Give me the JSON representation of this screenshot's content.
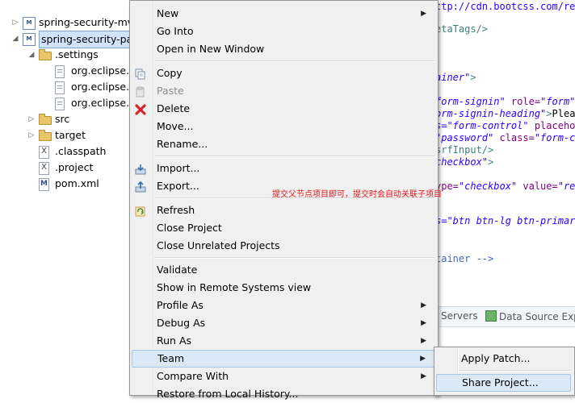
{
  "explorer": {
    "items": [
      {
        "label": "spring-security-mv",
        "icon": "maven-project-icon",
        "arrow": "▷",
        "selected": false
      },
      {
        "label": "spring-security-par",
        "icon": "maven-project-icon",
        "arrow": "◢",
        "selected": true
      },
      {
        "label": ".settings",
        "icon": "folder-open-icon",
        "arrow": "◢",
        "selected": false
      },
      {
        "label": "org.eclipse.c",
        "icon": "file-icon",
        "arrow": "",
        "selected": false
      },
      {
        "label": "org.eclipse.j",
        "icon": "file-icon",
        "arrow": "",
        "selected": false
      },
      {
        "label": "org.eclipse.r",
        "icon": "file-icon",
        "arrow": "",
        "selected": false
      },
      {
        "label": "src",
        "icon": "folder-icon",
        "arrow": "▷",
        "selected": false
      },
      {
        "label": "target",
        "icon": "folder-icon",
        "arrow": "▷",
        "selected": false
      },
      {
        "label": ".classpath",
        "icon": "xml-file-icon",
        "arrow": "",
        "selected": false
      },
      {
        "label": ".project",
        "icon": "xml-file-icon",
        "arrow": "",
        "selected": false
      },
      {
        "label": "pom.xml",
        "icon": "maven-file-icon",
        "arrow": "",
        "selected": false
      }
    ]
  },
  "editor": {
    "lines": [
      {
        "parts": [
          {
            "t": "url",
            "v": "ttp://cdn.bootcss.com/res"
          }
        ]
      },
      {
        "parts": [
          {
            "t": "tag",
            "v": "etaTags/>"
          }
        ]
      },
      {
        "parts": [
          {
            "t": "str",
            "v": "ainer\""
          },
          {
            "t": "tag",
            "v": ">"
          }
        ]
      },
      {
        "parts": [
          {
            "t": "str",
            "v": "form-signin\""
          },
          {
            "t": "attr",
            "v": " role="
          },
          {
            "t": "str",
            "v": "\"form\""
          }
        ]
      },
      {
        "parts": [
          {
            "t": "str",
            "v": "orm-signin-heading\""
          },
          {
            "t": "tag",
            "v": ">"
          },
          {
            "t": "txt",
            "v": "Pleas"
          }
        ]
      },
      {
        "parts": [
          {
            "t": "str",
            "v": "s=\"form-control\""
          },
          {
            "t": "attr",
            "v": " placehol"
          }
        ]
      },
      {
        "parts": [
          {
            "t": "str",
            "v": "\"password\""
          },
          {
            "t": "attr",
            "v": " class="
          },
          {
            "t": "str",
            "v": "\"form-co"
          }
        ]
      },
      {
        "parts": [
          {
            "t": "tag",
            "v": "srfInput/>"
          }
        ]
      },
      {
        "parts": [
          {
            "t": "str",
            "v": "checkbox\""
          },
          {
            "t": "tag",
            "v": ">"
          }
        ]
      },
      {
        "parts": [
          {
            "t": "attr",
            "v": "ype="
          },
          {
            "t": "str",
            "v": "\"checkbox\""
          },
          {
            "t": "attr",
            "v": " value="
          },
          {
            "t": "str",
            "v": "\"rem"
          }
        ]
      },
      {
        "parts": [
          {
            "t": "str",
            "v": "s=\"btn btn-lg btn-primary"
          }
        ]
      },
      {
        "parts": [
          {
            "t": "cmt",
            "v": "tainer -->"
          }
        ]
      }
    ]
  },
  "views": {
    "tabs": [
      {
        "label": "Servers",
        "icon": "servers-icon"
      },
      {
        "label": "Data Source Exp",
        "icon": "data-source-explorer-icon"
      }
    ]
  },
  "annotation": "提交父节点项目即可，提交时会自动关联子项目",
  "context_menu": {
    "items": [
      {
        "label": "New",
        "submenu": true
      },
      {
        "label": "Go Into"
      },
      {
        "label": "Open in New Window"
      },
      {
        "sep": true
      },
      {
        "label": "Copy",
        "icon": "copy-icon"
      },
      {
        "label": "Paste",
        "icon": "paste-icon",
        "disabled": true
      },
      {
        "label": "Delete",
        "icon": "delete-icon"
      },
      {
        "label": "Move..."
      },
      {
        "label": "Rename..."
      },
      {
        "sep": true
      },
      {
        "label": "Import...",
        "icon": "import-icon"
      },
      {
        "label": "Export...",
        "icon": "export-icon"
      },
      {
        "sep": true
      },
      {
        "label": "Refresh",
        "icon": "refresh-icon"
      },
      {
        "label": "Close Project"
      },
      {
        "label": "Close Unrelated Projects"
      },
      {
        "sep": true
      },
      {
        "label": "Validate"
      },
      {
        "label": "Show in Remote Systems view"
      },
      {
        "label": "Profile As",
        "submenu": true
      },
      {
        "label": "Debug As",
        "submenu": true
      },
      {
        "label": "Run As",
        "submenu": true
      },
      {
        "label": "Team",
        "submenu": true,
        "active": true
      },
      {
        "label": "Compare With",
        "submenu": true
      },
      {
        "label": "Restore from Local History..."
      }
    ]
  },
  "team_submenu": {
    "items": [
      {
        "label": "Apply Patch..."
      },
      {
        "sep": true
      },
      {
        "label": "Share Project...",
        "active": true
      }
    ]
  },
  "colors": {
    "selection": "#cfe3fa",
    "menu_bg": "#f0f0f0",
    "menu_hover": "#dbe9f7",
    "annotation": "#e0161b"
  }
}
